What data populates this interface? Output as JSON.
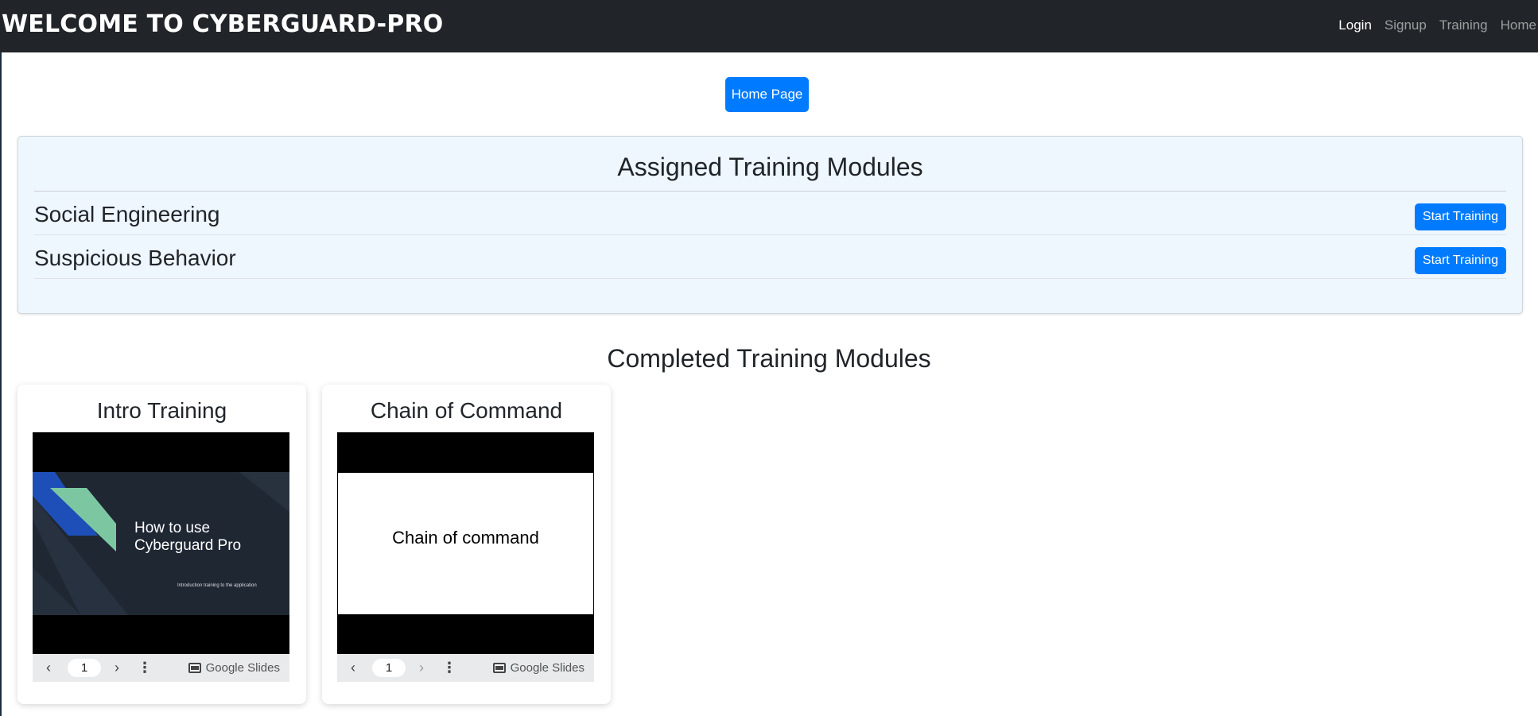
{
  "navbar": {
    "brand": "WELCOME TO CYBERGUARD-PRO",
    "links": [
      {
        "label": "Login",
        "active": true
      },
      {
        "label": "Signup",
        "active": false
      },
      {
        "label": "Training",
        "active": false
      },
      {
        "label": "Home",
        "active": false
      }
    ]
  },
  "home_button": "Home Page",
  "assigned": {
    "title": "Assigned Training Modules",
    "modules": [
      {
        "name": "Social Engineering",
        "button": "Start Training"
      },
      {
        "name": "Suspicious Behavior",
        "button": "Start Training"
      }
    ]
  },
  "completed": {
    "title": "Completed Training Modules",
    "cards": [
      {
        "title": "Intro Training",
        "slide_title": "How to use Cyberguard Pro",
        "slide_subtitle": "Introduction training to the application",
        "page": "1",
        "provider": "Google Slides"
      },
      {
        "title": "Chain of Command",
        "slide_title": "Chain of command",
        "page": "1",
        "provider": "Google Slides"
      }
    ]
  },
  "colors": {
    "navbar_bg": "#212529",
    "primary": "#007bff",
    "assigned_bg": "#eef6fe",
    "slide_dark": "#1f2733",
    "slide_blue": "#1e4fb8",
    "slide_mint": "#7cc7a2"
  },
  "icons": {
    "prev": "chevron-left-icon",
    "next": "chevron-right-icon",
    "more": "more-vertical-icon",
    "provider": "google-slides-icon"
  }
}
